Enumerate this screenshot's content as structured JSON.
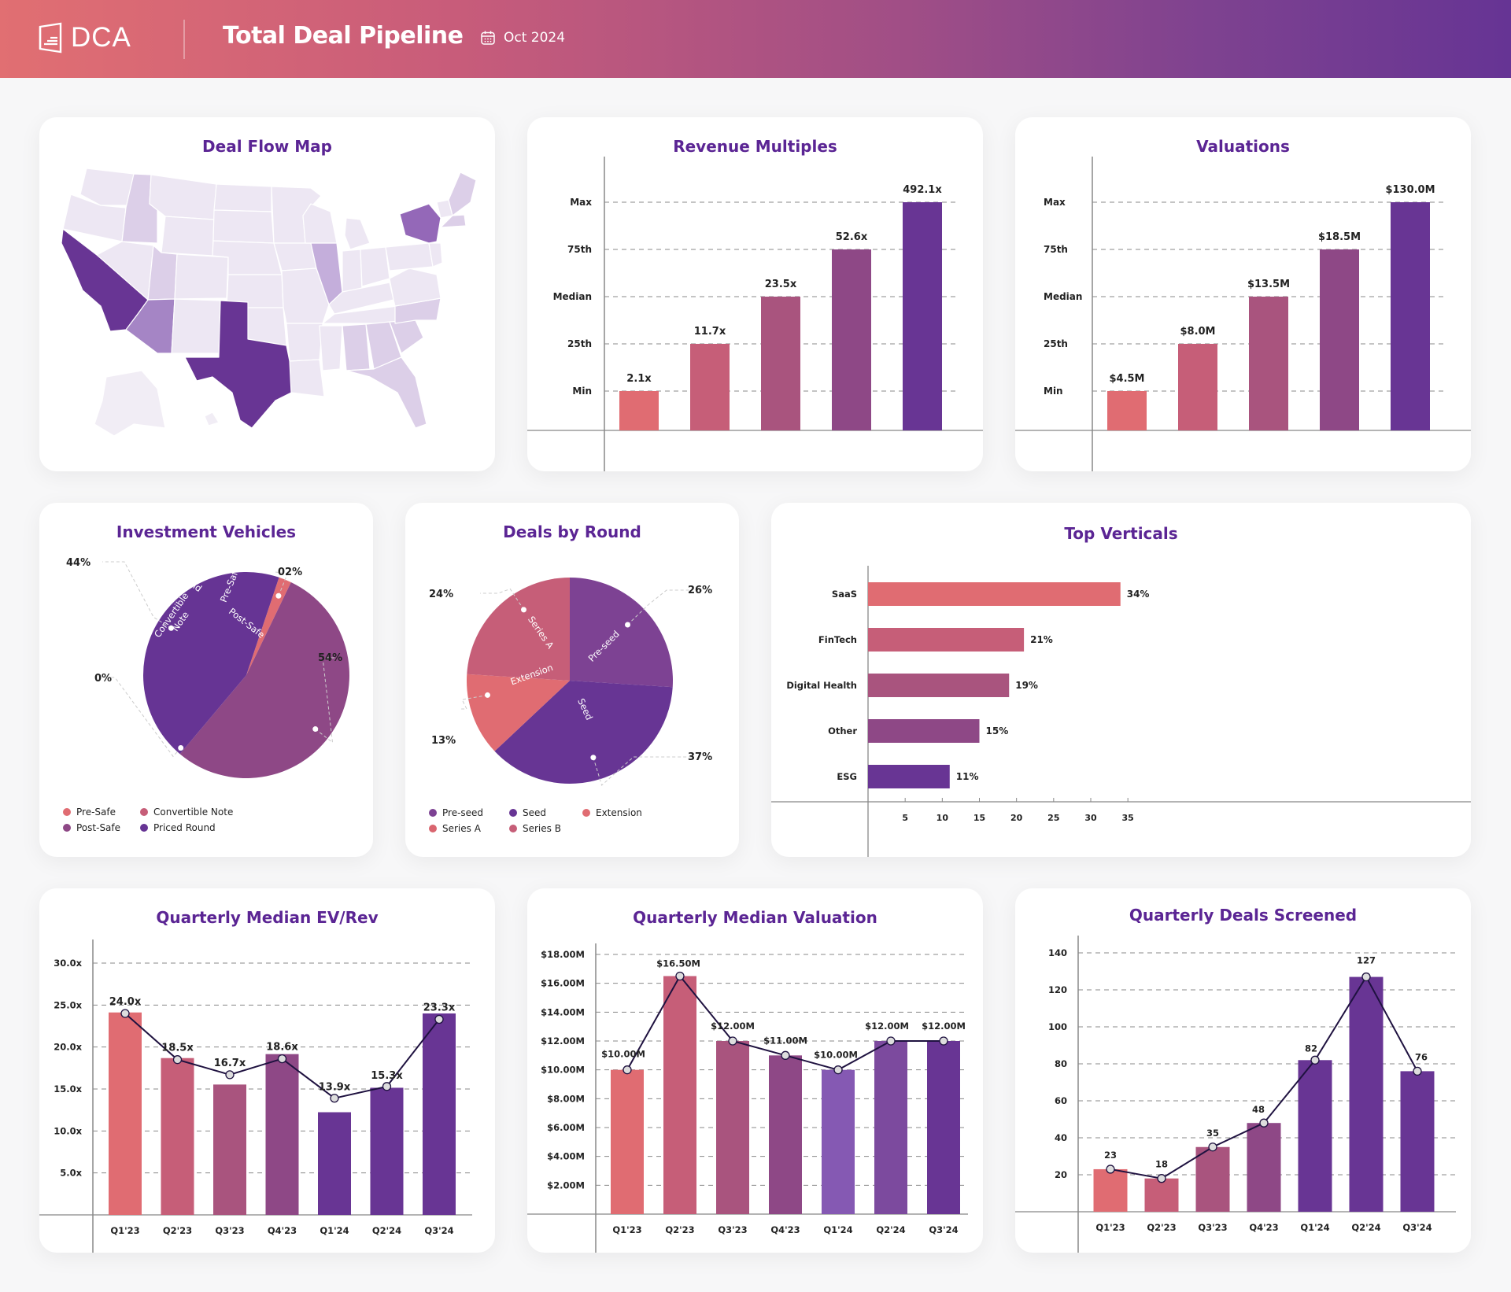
{
  "header": {
    "logo_text": "DCA",
    "title": "Total Deal Pipeline",
    "date": "Oct 2024",
    "icons": {
      "logo": "building-logo-icon",
      "date": "calendar-icon"
    },
    "gradient": [
      "#E16F72",
      "#663494"
    ]
  },
  "colors": {
    "title": "#5B2594",
    "palette": [
      "#E06C72",
      "#C65E78",
      "#A9547E",
      "#8E4886",
      "#683594"
    ],
    "valuation_palette": [
      "#E06C72",
      "#C65E78",
      "#A9547E",
      "#8E4886",
      "#8559B3",
      "#7C4A9E",
      "#683594"
    ],
    "map": {
      "base": "#EDE7F3",
      "light": "#DCCFE8",
      "mid": "#C4AEDB",
      "strong": "#A585C5",
      "darker": "#9468B8",
      "max": "#683594"
    }
  },
  "map": {
    "title": "Deal Flow Map",
    "states_highlighted": [
      {
        "state": "California",
        "level": "max"
      },
      {
        "state": "Texas",
        "level": "max"
      },
      {
        "state": "New York",
        "level": "darker"
      },
      {
        "state": "Arizona",
        "level": "strong"
      },
      {
        "state": "Illinois",
        "level": "mid"
      },
      {
        "state": "Idaho",
        "level": "light"
      },
      {
        "state": "Utah",
        "level": "light"
      },
      {
        "state": "Southeast",
        "level": "light"
      },
      {
        "state": "Maine",
        "level": "light"
      },
      {
        "state": "Massachusetts",
        "level": "light"
      }
    ]
  },
  "chart_data": [
    {
      "id": "revenue_multiples",
      "type": "bar",
      "title": "Revenue Multiples",
      "categories": [
        "Min",
        "25th",
        "Median",
        "75th",
        "Max"
      ],
      "values": [
        2.1,
        11.7,
        23.5,
        52.6,
        492.1
      ],
      "labels": [
        "2.1x",
        "11.7x",
        "23.5x",
        "52.6x",
        "492.1x"
      ],
      "yticks": [
        "Min",
        "25th",
        "Median",
        "75th",
        "Max"
      ],
      "grid": true
    },
    {
      "id": "valuations",
      "type": "bar",
      "title": "Valuations",
      "categories": [
        "Min",
        "25th",
        "Median",
        "75th",
        "Max"
      ],
      "values": [
        4.5,
        8.0,
        13.5,
        18.5,
        130.0
      ],
      "labels": [
        "$4.5M",
        "$8.0M",
        "$13.5M",
        "$18.5M",
        "$130.0M"
      ],
      "yticks": [
        "Min",
        "25th",
        "Median",
        "75th",
        "Max"
      ],
      "grid": true
    },
    {
      "id": "investment_vehicles",
      "type": "pie",
      "title": "Investment Vehicles",
      "slices": [
        {
          "name": "Pre-Safe",
          "value": 2,
          "label": "02%",
          "color": "#E06C72"
        },
        {
          "name": "Post-Safe",
          "value": 54,
          "label": "54%",
          "color": "#8E4886"
        },
        {
          "name": "Convertible Note",
          "value": 0,
          "label": "0%",
          "color": "#C65E78"
        },
        {
          "name": "Priced Round",
          "value": 44,
          "label": "44%",
          "color": "#663494"
        }
      ],
      "legend": [
        {
          "name": "Pre-Safe",
          "color": "#E06C72"
        },
        {
          "name": "Convertible Note",
          "color": "#C65E78"
        },
        {
          "name": "Post-Safe",
          "color": "#8E4886"
        },
        {
          "name": "Priced Round",
          "color": "#663494"
        }
      ],
      "legend_position": "bottom-left"
    },
    {
      "id": "deals_by_round",
      "type": "pie",
      "title": "Deals by Round",
      "slices": [
        {
          "name": "Pre-seed",
          "value": 26,
          "label": "26%",
          "color": "#7D4293"
        },
        {
          "name": "Seed",
          "value": 37,
          "label": "37%",
          "color": "#673594"
        },
        {
          "name": "Extension",
          "value": 13,
          "label": "13%",
          "color": "#E06C72"
        },
        {
          "name": "Series A",
          "value": 24,
          "label": "24%",
          "color": "#C65E78"
        }
      ],
      "legend": [
        {
          "name": "Pre-seed",
          "color": "#7D4293"
        },
        {
          "name": "Seed",
          "color": "#673594"
        },
        {
          "name": "Extension",
          "color": "#E06C72"
        },
        {
          "name": "Series A",
          "color": "#D9656F"
        },
        {
          "name": "Series B",
          "color": "#C65E78"
        }
      ],
      "legend_position": "bottom-left"
    },
    {
      "id": "top_verticals",
      "type": "bar",
      "orientation": "horizontal",
      "title": "Top Verticals",
      "categories": [
        "SaaS",
        "FinTech",
        "Digital Health",
        "Other",
        "ESG"
      ],
      "values": [
        34,
        21,
        19,
        15,
        11
      ],
      "labels": [
        "34%",
        "21%",
        "19%",
        "15%",
        "11%"
      ],
      "xticks": [
        5,
        10,
        15,
        20,
        25,
        30,
        35
      ],
      "xlim": [
        0,
        40
      ]
    },
    {
      "id": "quarterly_ev_rev",
      "type": "bar",
      "title": "Quarterly Median EV/Rev",
      "categories": [
        "Q1'23",
        "Q2'23",
        "Q3'23",
        "Q4'23",
        "Q1'24",
        "Q2'24",
        "Q3'24"
      ],
      "values": [
        24.0,
        18.5,
        16.7,
        18.6,
        13.9,
        15.3,
        23.3
      ],
      "labels": [
        "24.0x",
        "18.5x",
        "16.7x",
        "18.6x",
        "13.9x",
        "15.3x",
        "23.3x"
      ],
      "overlay_line": true,
      "yticks": [
        "5.0x",
        "10.0x",
        "15.0x",
        "20.0x",
        "25.0x",
        "30.0x"
      ],
      "ytick_values": [
        5,
        10,
        15,
        20,
        25,
        30
      ],
      "ylim": [
        0,
        36
      ],
      "grid": true
    },
    {
      "id": "quarterly_valuation",
      "type": "bar",
      "title": "Quarterly Median Valuation",
      "categories": [
        "Q1'23",
        "Q2'23",
        "Q3'23",
        "Q4'23",
        "Q1'24",
        "Q2'24",
        "Q3'24"
      ],
      "values": [
        10.0,
        16.5,
        12.0,
        11.0,
        10.0,
        12.0,
        12.0
      ],
      "labels": [
        "$10.00M",
        "$16.50M",
        "$12.00M",
        "$11.00M",
        "$10.00M",
        "$12.00M",
        "$12.00M"
      ],
      "overlay_line": true,
      "yticks": [
        "$2.00M",
        "$4.00M",
        "$6.00M",
        "$8.00M",
        "$10.00M",
        "$12.00M",
        "$14.00M",
        "$16.00M",
        "$18.00M"
      ],
      "ytick_values": [
        2,
        4,
        6,
        8,
        10,
        12,
        14,
        16,
        18
      ],
      "ylim": [
        0,
        18
      ],
      "grid": true
    },
    {
      "id": "quarterly_deals",
      "type": "bar",
      "title": "Quarterly Deals Screened",
      "categories": [
        "Q1'23",
        "Q2'23",
        "Q3'23",
        "Q4'23",
        "Q1'24",
        "Q2'24",
        "Q3'24"
      ],
      "values": [
        23,
        18,
        35,
        48,
        82,
        127,
        76
      ],
      "labels": [
        "23",
        "18",
        "35",
        "48",
        "82",
        "127",
        "76"
      ],
      "overlay_line": true,
      "yticks": [
        "20",
        "40",
        "60",
        "80",
        "100",
        "120",
        "140"
      ],
      "ytick_values": [
        20,
        40,
        60,
        80,
        100,
        120,
        140
      ],
      "ylim": [
        0,
        140
      ],
      "grid": true
    }
  ]
}
